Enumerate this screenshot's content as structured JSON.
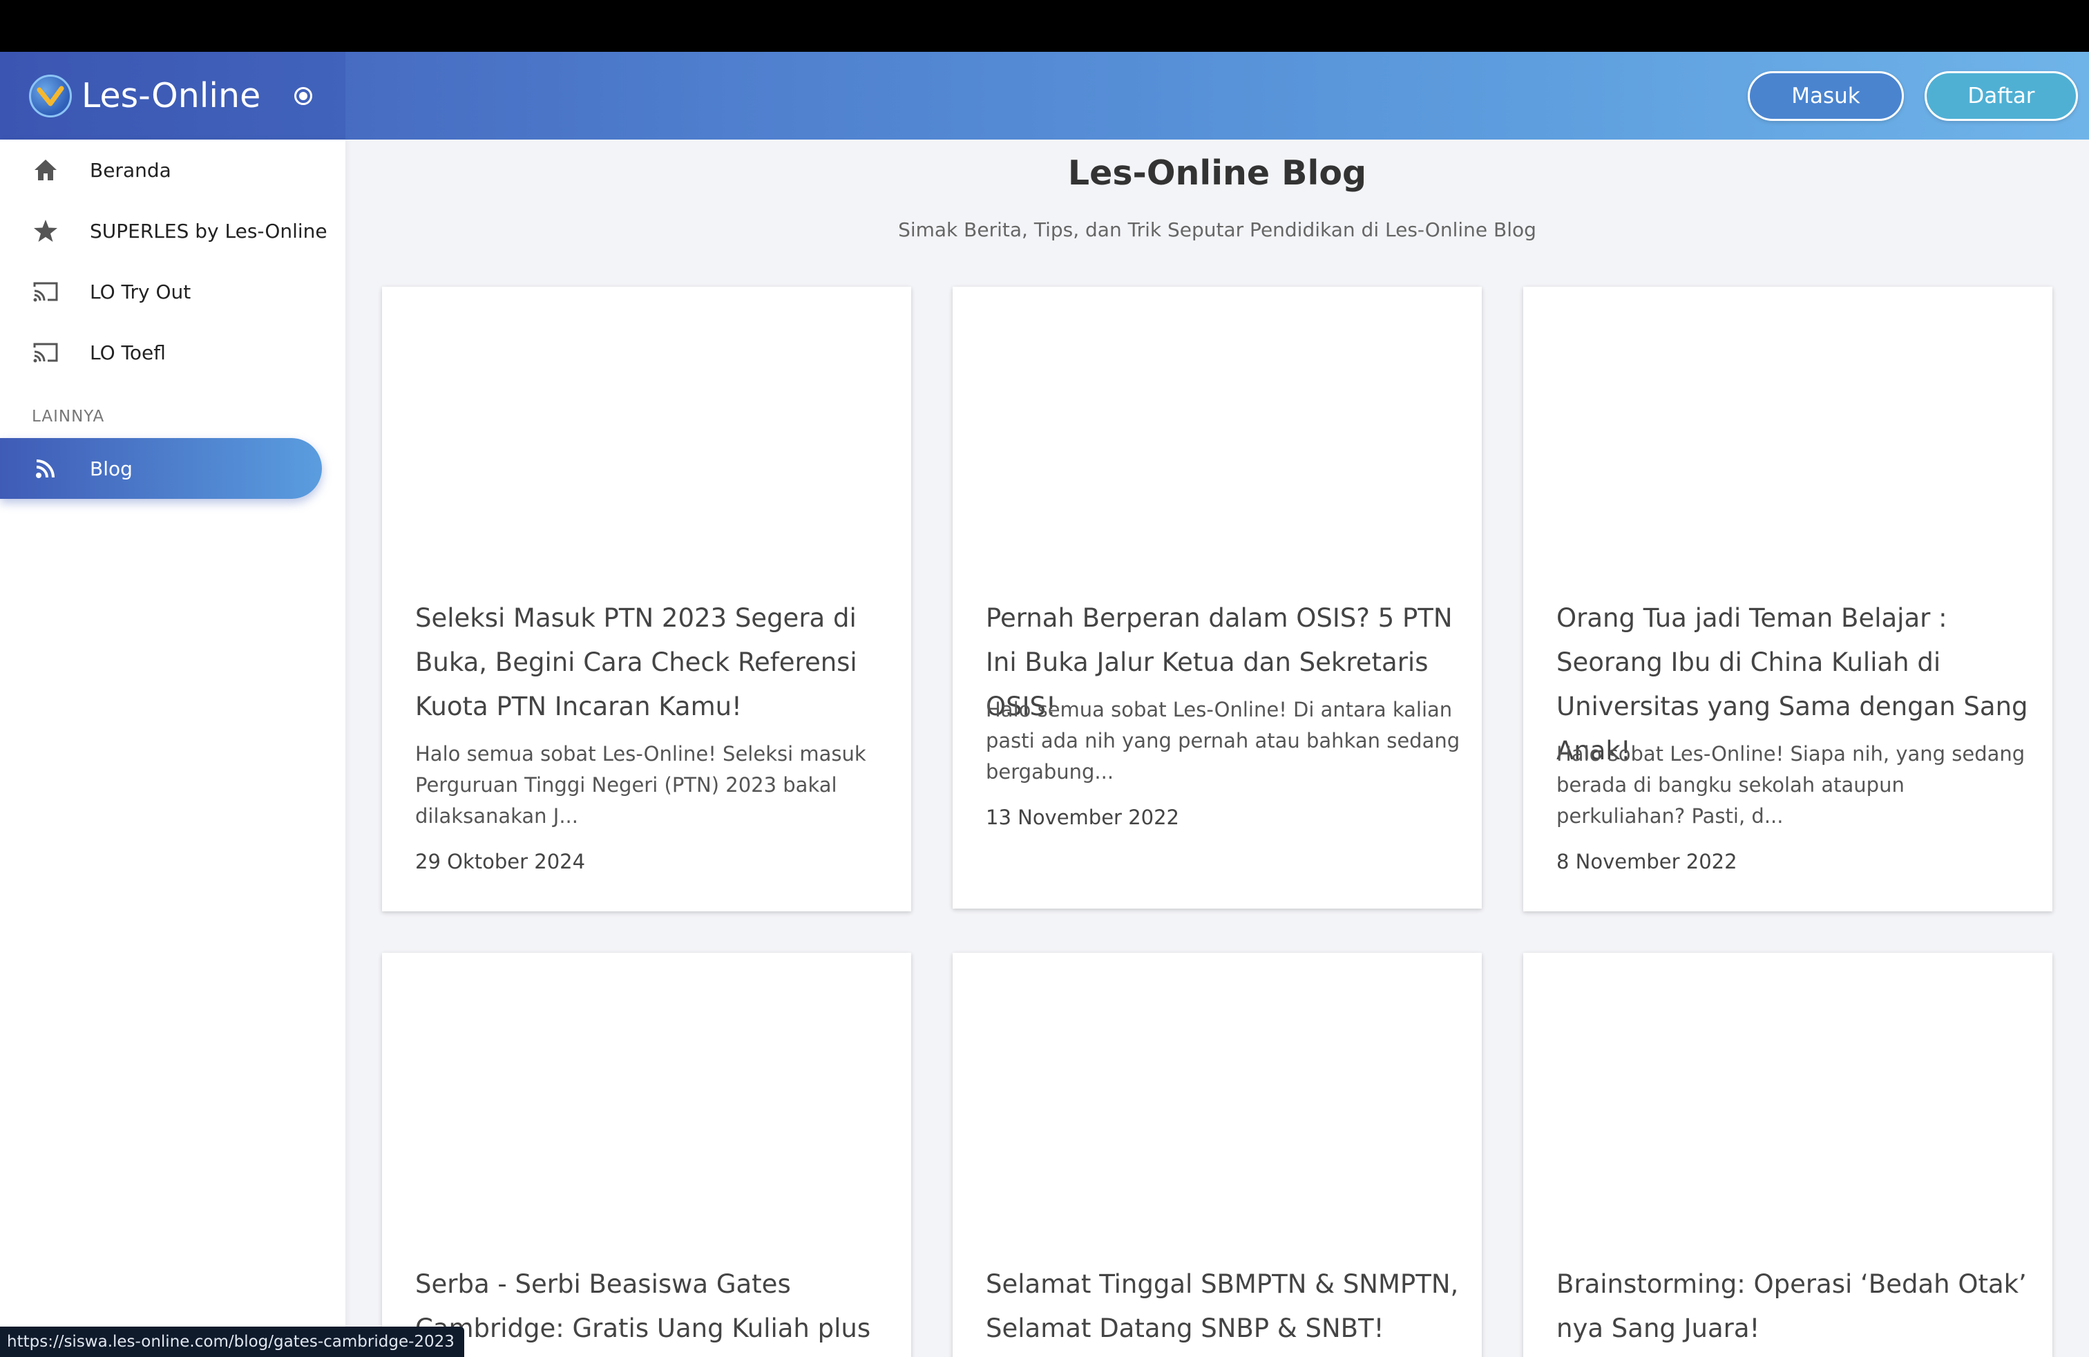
{
  "header": {
    "brand": "Les-Online",
    "login_label": "Masuk",
    "register_label": "Daftar"
  },
  "sidebar": {
    "items": [
      {
        "label": "Beranda",
        "icon": "home-icon"
      },
      {
        "label": "SUPERLES by Les-Online",
        "icon": "star-icon"
      },
      {
        "label": "LO Try Out",
        "icon": "cast-icon"
      },
      {
        "label": "LO Toefl",
        "icon": "cast-icon"
      }
    ],
    "section_label": "LAINNYA",
    "active_item": {
      "label": "Blog",
      "icon": "rss-icon"
    }
  },
  "main": {
    "title": "Les-Online Blog",
    "subtitle": "Simak Berita, Tips, dan Trik Seputar Pendidikan di Les-Online Blog",
    "cards": [
      {
        "title": "Seleksi Masuk PTN 2023 Segera di Buka, Begini Cara Check Referensi Kuota PTN Incaran Kamu!",
        "excerpt": "Halo semua sobat Les-Online! Seleksi masuk Perguruan Tinggi Negeri (PTN) 2023 bakal dilaksanakan J...",
        "date": "29 Oktober 2024"
      },
      {
        "title": "Pernah Berperan dalam OSIS? 5 PTN Ini Buka Jalur Ketua dan Sekretaris OSIS!",
        "excerpt": "Halo semua sobat Les-Online! Di antara kalian pasti ada nih yang pernah atau bahkan sedang bergabung...",
        "date": "13 November 2022"
      },
      {
        "title": "Orang Tua jadi Teman Belajar : Seorang Ibu di China Kuliah di Universitas yang Sama dengan Sang Anak!",
        "excerpt": "Halo sobat Les-Online! Siapa nih, yang sedang berada di bangku sekolah ataupun perkuliahan? Pasti, d...",
        "date": "8 November 2022"
      },
      {
        "title": "Serba - Serbi Beasiswa Gates Cambridge: Gratis Uang Kuliah plus",
        "excerpt": "",
        "date": ""
      },
      {
        "title": "Selamat Tinggal SBMPTN & SNMPTN, Selamat Datang SNBP & SNBT!",
        "excerpt": "",
        "date": ""
      },
      {
        "title": "Brainstorming: Operasi ‘Bedah Otak’ nya Sang Juara!",
        "excerpt": "",
        "date": ""
      }
    ]
  },
  "status_bar": {
    "url": "https://siswa.les-online.com/blog/gates-cambridge-2023"
  },
  "colors": {
    "header_start": "#3f5bb6",
    "header_end": "#6fb4e9",
    "page_bg": "#f3f4f7",
    "active_start": "#3f5bb6",
    "active_end": "#5a9ddf"
  }
}
